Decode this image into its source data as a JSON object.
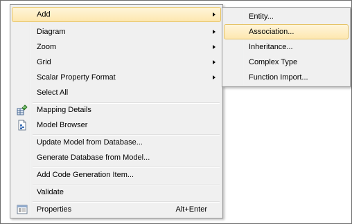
{
  "main_menu": {
    "items": [
      {
        "label": "Add",
        "submenu": true
      },
      {
        "label": "Diagram",
        "submenu": true
      },
      {
        "label": "Zoom",
        "submenu": true
      },
      {
        "label": "Grid",
        "submenu": true
      },
      {
        "label": "Scalar Property Format",
        "submenu": true
      },
      {
        "label": "Select All"
      },
      {
        "label": "Mapping Details",
        "icon": "mapping-details-icon"
      },
      {
        "label": "Model Browser",
        "icon": "model-browser-icon"
      },
      {
        "label": "Update Model from Database..."
      },
      {
        "label": "Generate Database from Model..."
      },
      {
        "label": "Add Code Generation Item..."
      },
      {
        "label": "Validate"
      },
      {
        "label": "Properties",
        "shortcut": "Alt+Enter",
        "icon": "properties-icon"
      }
    ]
  },
  "add_submenu": {
    "items": [
      {
        "label": "Entity..."
      },
      {
        "label": "Association..."
      },
      {
        "label": "Inheritance..."
      },
      {
        "label": "Complex Type"
      },
      {
        "label": "Function Import..."
      }
    ]
  },
  "colors": {
    "highlight_top": "#fff5d9",
    "highlight_bottom": "#fde7b0",
    "highlight_border": "#e5c365",
    "menu_background": "#f0f0f0"
  }
}
